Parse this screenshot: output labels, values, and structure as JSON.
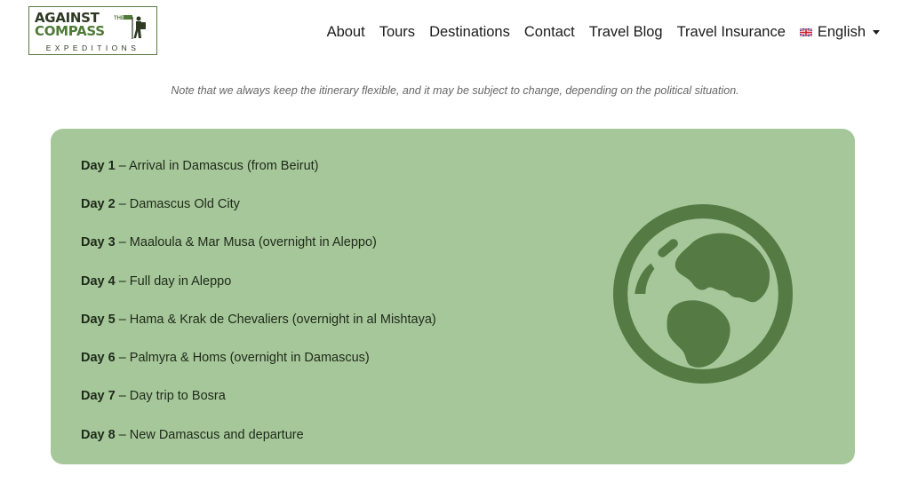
{
  "logo": {
    "line1": "AGAINST",
    "the": "THE",
    "line2": "COMPASS",
    "line3": "EXPEDITIONS"
  },
  "nav": {
    "items": [
      "About",
      "Tours",
      "Destinations",
      "Contact",
      "Travel Blog",
      "Travel Insurance"
    ],
    "language": "English"
  },
  "note": "Note that we always keep the itinerary flexible, and it may be subject to change, depending on the political situation.",
  "itinerary": {
    "days": [
      {
        "label": "Day 1",
        "text": "– Arrival in Damascus (from Beirut)"
      },
      {
        "label": "Day 2",
        "text": "– Damascus Old City"
      },
      {
        "label": "Day 3",
        "text": "– Maaloula & Mar Musa (overnight in Aleppo)"
      },
      {
        "label": "Day 4",
        "text": "– Full day in Aleppo"
      },
      {
        "label": "Day 5",
        "text": "– Hama & Krak de Chevaliers (overnight in al Mishtaya)"
      },
      {
        "label": "Day 6",
        "text": "– Palmyra & Homs (overnight in Damascus)"
      },
      {
        "label": "Day 7",
        "text": "– Day trip to Bosra"
      },
      {
        "label": "Day 8",
        "text": "– New Damascus and departure"
      }
    ]
  },
  "colors": {
    "card_bg": "#a6c79a",
    "globe": "#567a43",
    "brand_green": "#4f7a38"
  },
  "icons": {
    "globe": "globe-icon",
    "flag": "uk-flag-icon",
    "caret": "caret-down-icon",
    "hiker": "hiker-icon"
  }
}
